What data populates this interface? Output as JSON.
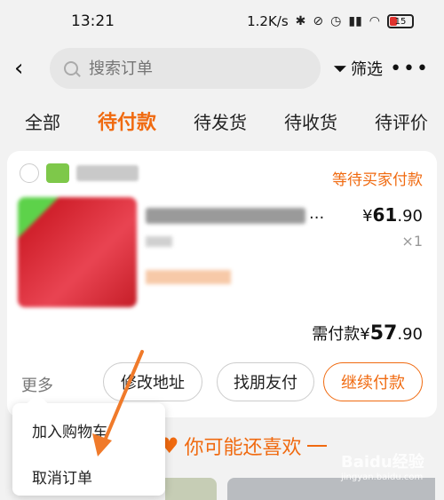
{
  "status_bar": {
    "time": "13:21",
    "network_speed": "1.2K/s",
    "battery": "15"
  },
  "search": {
    "placeholder": "搜索订单",
    "filter_label": "筛选"
  },
  "tabs": [
    {
      "label": "全部",
      "active": false
    },
    {
      "label": "待付款",
      "active": true
    },
    {
      "label": "待发货",
      "active": false
    },
    {
      "label": "待收货",
      "active": false
    },
    {
      "label": "待评价",
      "active": false
    }
  ],
  "order": {
    "status": "等待买家付款",
    "title_suffix": "...",
    "price_symbol": "¥",
    "price_main": "61",
    "price_decimal": ".90",
    "quantity": "×1",
    "total_label": "需付款",
    "total_symbol": "¥",
    "total_main": "57",
    "total_decimal": ".90"
  },
  "actions": {
    "more": "更多",
    "modify_address": "修改地址",
    "friend_pay": "找朋友付",
    "continue_pay": "继续付款"
  },
  "popup_menu": {
    "add_cart": "加入购物车",
    "cancel_order": "取消订单"
  },
  "recommend": {
    "title": "你可能还喜欢"
  },
  "watermark": {
    "line1": "Baidu经验",
    "line2": "jingyan.baidu.com"
  },
  "colors": {
    "accent": "#f06a10",
    "arrow": "#f07a2a"
  }
}
